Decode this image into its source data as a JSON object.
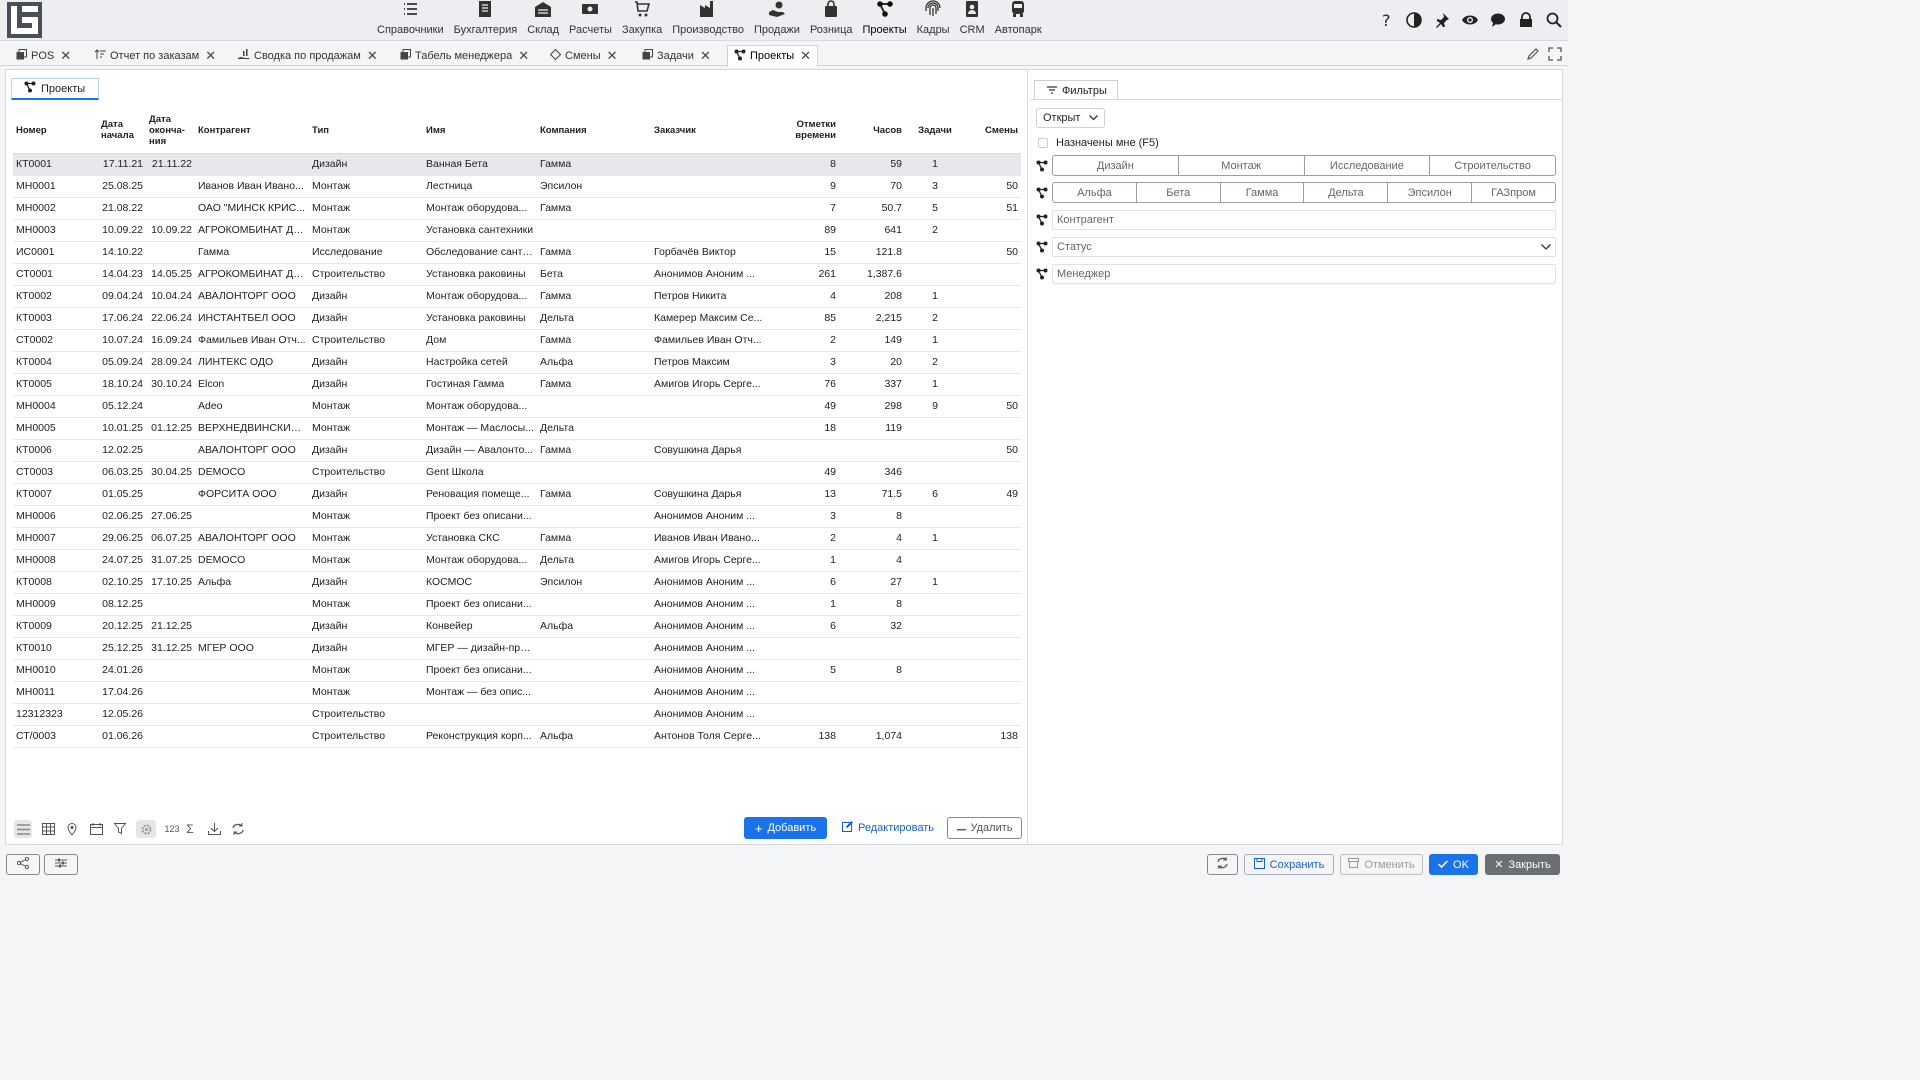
{
  "menu": [
    {
      "label": "Справочники",
      "icon": "list-icon"
    },
    {
      "label": "Бухгалтерия",
      "icon": "ledger-icon"
    },
    {
      "label": "Склад",
      "icon": "warehouse-icon"
    },
    {
      "label": "Расчеты",
      "icon": "money-icon"
    },
    {
      "label": "Закупка",
      "icon": "cart-icon"
    },
    {
      "label": "Производство",
      "icon": "factory-icon"
    },
    {
      "label": "Продажи",
      "icon": "hand-coin-icon"
    },
    {
      "label": "Розница",
      "icon": "bag-icon"
    },
    {
      "label": "Проекты",
      "icon": "project-icon",
      "active": true
    },
    {
      "label": "Кадры",
      "icon": "fingerprint-icon"
    },
    {
      "label": "CRM",
      "icon": "contact-icon"
    },
    {
      "label": "Автопарк",
      "icon": "bus-icon"
    }
  ],
  "tabs": [
    {
      "label": "POS"
    },
    {
      "label": "Отчет по заказам"
    },
    {
      "label": "Сводка по продажам"
    },
    {
      "label": "Табель менеджера"
    },
    {
      "label": "Смены"
    },
    {
      "label": "Задачи"
    },
    {
      "label": "Проекты",
      "active": true
    }
  ],
  "panel_tab": "Проекты",
  "table": {
    "headers": {
      "number": "Номер",
      "start": "Дата начала",
      "end": "Дата оконча-ния",
      "contractor": "Контрагент",
      "type": "Тип",
      "name": "Имя",
      "company": "Компания",
      "customer": "Заказчик",
      "time_marks": "Отметки времени",
      "hours": "Часов",
      "tasks": "Задачи",
      "shifts": "Смены"
    },
    "rows": [
      [
        "КТ0001",
        "17.11.21",
        "21.11.22",
        "",
        "Дизайн",
        "Ванная Бета",
        "Гамма",
        "",
        "8",
        "59",
        "1",
        ""
      ],
      [
        "МН0001",
        "25.08.25",
        "",
        "Иванов Иван Ивано...",
        "Монтаж",
        "Лестница",
        "Эпсилон",
        "",
        "9",
        "70",
        "3",
        "50"
      ],
      [
        "МН0002",
        "21.08.22",
        "",
        "ОАО \"МИНСК КРИС...",
        "Монтаж",
        "Монтаж оборудова...",
        "Гамма",
        "",
        "7",
        "50.7",
        "5",
        "51"
      ],
      [
        "МН0003",
        "10.09.22",
        "10.09.22",
        "АГРОКОМБИНАТ ДЗ...",
        "Монтаж",
        "Установка сантехники",
        "",
        "",
        "89",
        "641",
        "2",
        ""
      ],
      [
        "ИС0001",
        "14.10.22",
        "",
        "Гамма",
        "Исследование",
        "Обследование санте...",
        "Гамма",
        "Горбачёв Виктор",
        "15",
        "121.8",
        "",
        "50"
      ],
      [
        "СТ0001",
        "14.04.23",
        "14.05.25",
        "АГРОКОМБИНАТ ДЗ...",
        "Строительство",
        "Установка раковины",
        "Бета",
        "Анонимов Аноним ...",
        "261",
        "1,387.6",
        "",
        ""
      ],
      [
        "КТ0002",
        "09.04.24",
        "10.04.24",
        "АВАЛОНТОРГ ООО",
        "Дизайн",
        "Монтаж оборудова...",
        "Гамма",
        "Петров Никита",
        "4",
        "208",
        "1",
        ""
      ],
      [
        "КТ0003",
        "17.06.24",
        "22.06.24",
        "ИНСТАНТБЕЛ ООО",
        "Дизайн",
        "Установка раковины",
        "Дельта",
        "Камерер Максим Се...",
        "85",
        "2,215",
        "2",
        ""
      ],
      [
        "СТ0002",
        "10.07.24",
        "16.09.24",
        "Фамильев Иван Отч...",
        "Строительство",
        "Дом",
        "Гамма",
        "Фамильев Иван Отч...",
        "2",
        "149",
        "1",
        ""
      ],
      [
        "КТ0004",
        "05.09.24",
        "28.09.24",
        "ЛИНТЕКС ОДО",
        "Дизайн",
        "Настройка сетей",
        "Альфа",
        "Петров Максим",
        "3",
        "20",
        "2",
        ""
      ],
      [
        "КТ0005",
        "18.10.24",
        "30.10.24",
        "Elcon",
        "Дизайн",
        "Гостиная Гамма",
        "Гамма",
        "Амигов Игорь Серге...",
        "76",
        "337",
        "1",
        ""
      ],
      [
        "МН0004",
        "05.12.24",
        "",
        "Adeo",
        "Монтаж",
        "Монтаж оборудова...",
        "",
        "",
        "49",
        "298",
        "9",
        "50"
      ],
      [
        "МН0005",
        "10.01.25",
        "01.12.25",
        "ВЕРХНЕДВИНСКИЙ ...",
        "Монтаж",
        "Монтаж — Маслосы...",
        "Дельта",
        "",
        "18",
        "119",
        "",
        ""
      ],
      [
        "КТ0006",
        "12.02.25",
        "",
        "АВАЛОНТОРГ ООО",
        "Дизайн",
        "Дизайн — Авалонто...",
        "Гамма",
        "Совушкина Дарья",
        "",
        "",
        "",
        "50"
      ],
      [
        "СТ0003",
        "06.03.25",
        "30.04.25",
        "DEMOCO",
        "Строительство",
        "Gent Школа",
        "",
        "",
        "49",
        "346",
        "",
        ""
      ],
      [
        "КТ0007",
        "01.05.25",
        "",
        "ФОРСИТА ООО",
        "Дизайн",
        "Реновация помеще...",
        "Гамма",
        "Совушкина Дарья",
        "13",
        "71.5",
        "6",
        "49"
      ],
      [
        "МН0006",
        "02.06.25",
        "27.06.25",
        "",
        "Монтаж",
        "Проект без описани...",
        "",
        "Анонимов Аноним ...",
        "3",
        "8",
        "",
        ""
      ],
      [
        "МН0007",
        "29.06.25",
        "06.07.25",
        "АВАЛОНТОРГ ООО",
        "Монтаж",
        "Установка СКС",
        "Гамма",
        "Иванов Иван Ивано...",
        "2",
        "4",
        "1",
        ""
      ],
      [
        "МН0008",
        "24.07.25",
        "31.07.25",
        "DEMOCO",
        "Монтаж",
        "Монтаж оборудова...",
        "Дельта",
        "Амигов Игорь Серге...",
        "1",
        "4",
        "",
        ""
      ],
      [
        "КТ0008",
        "02.10.25",
        "17.10.25",
        "Альфа",
        "Дизайн",
        "КОСМОС",
        "Эпсилон",
        "Анонимов Аноним ...",
        "6",
        "27",
        "1",
        ""
      ],
      [
        "МН0009",
        "08.12.25",
        "",
        "",
        "Монтаж",
        "Проект без описани...",
        "",
        "Анонимов Аноним ...",
        "1",
        "8",
        "",
        ""
      ],
      [
        "КТ0009",
        "20.12.25",
        "21.12.25",
        "",
        "Дизайн",
        "Конвейер",
        "Альфа",
        "Анонимов Аноним ...",
        "6",
        "32",
        "",
        ""
      ],
      [
        "КТ0010",
        "25.12.25",
        "31.12.25",
        "МГЕР ООО",
        "Дизайн",
        "МГЕР — дизайн-про...",
        "",
        "Анонимов Аноним ...",
        "",
        "",
        "",
        ""
      ],
      [
        "МН0010",
        "24.01.26",
        "",
        "",
        "Монтаж",
        "Проект без описани...",
        "",
        "Анонимов Аноним ...",
        "5",
        "8",
        "",
        ""
      ],
      [
        "МН0011",
        "17.04.26",
        "",
        "",
        "Монтаж",
        "Монтаж — без опис...",
        "",
        "Анонимов Аноним ...",
        "",
        "",
        "",
        ""
      ],
      [
        "12312323",
        "12.05.26",
        "",
        "",
        "Строительство",
        "",
        "",
        "Анонимов Аноним ...",
        "",
        "",
        "",
        ""
      ],
      [
        "СТ/0003",
        "01.06.26",
        "",
        "",
        "Строительство",
        "Реконструкция корп...",
        "Альфа",
        "Антонов Толя Серге...",
        "138",
        "1,074",
        "",
        "138"
      ]
    ]
  },
  "bottom": {
    "numbers_label": "123",
    "sum_label": "Σ",
    "add": "Добавить",
    "edit": "Редактировать",
    "delete": "Удалить"
  },
  "filters": {
    "tab": "Фильтры",
    "status_select": "Открыт",
    "assigned": "Назначены мне (F5)",
    "types": [
      "Дизайн",
      "Монтаж",
      "Исследование",
      "Строительство"
    ],
    "companies": [
      "Альфа",
      "Бета",
      "Гамма",
      "Дельта",
      "Эпсилон",
      "ГАЗпром"
    ],
    "contractor_placeholder": "Контрагент",
    "status_placeholder": "Статус",
    "manager_placeholder": "Менеджер"
  },
  "footer": {
    "save": "Сохранить",
    "cancel": "Отменить",
    "ok": "OK",
    "close": "Закрыть"
  },
  "colors": {
    "accent": "#1a73e8",
    "close_btn": "#6b6e72"
  }
}
